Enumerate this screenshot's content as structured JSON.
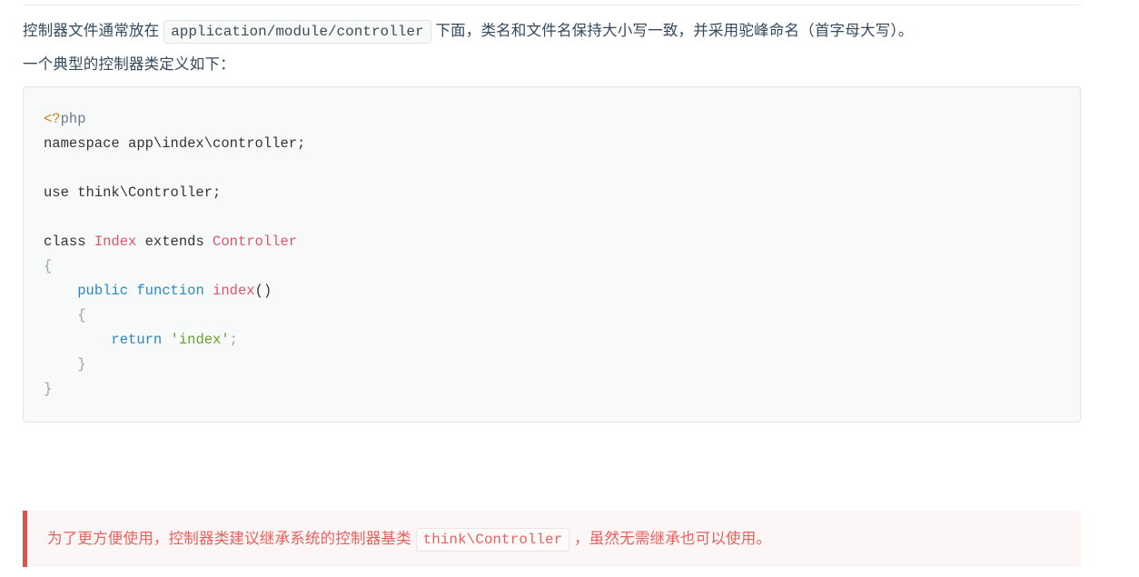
{
  "document": {
    "paragraphs": [
      {
        "id": "controller-location",
        "before": "控制器文件通常放在",
        "code": "application/module/controller",
        "after": "下面，类名和文件名保持大小写一致，并采用驼峰命名（首字母大写）。"
      },
      {
        "id": "typical-definition",
        "text": "一个典型的控制器类定义如下："
      }
    ],
    "code_block": {
      "language": "php",
      "lines": [
        "<?php",
        "namespace app\\index\\controller;",
        "",
        "use think\\Controller;",
        "",
        "class Index extends Controller",
        "{",
        "    public function index()",
        "    {",
        "        return 'index';",
        "    }",
        "}"
      ],
      "tokens": {
        "php_open": "<?",
        "php_word": "php",
        "namespace_line": "namespace app\\index\\controller;",
        "use_line": "use think\\Controller;",
        "class_keyword": "class ",
        "class_name": "Index",
        "extends_keyword": " extends ",
        "parent_class": "Controller",
        "brace_open_class": "{",
        "method_indent": "    ",
        "method_visibility": "public",
        "method_function_keyword": "function",
        "method_name": "index",
        "method_parens": "()",
        "brace_open_method": "    {",
        "return_indent": "        ",
        "return_keyword": "return",
        "return_value": "'index'",
        "return_semicolon": ";",
        "brace_close_method": "    }",
        "brace_close_class": "}"
      },
      "colors": {
        "background": "#f8faf9",
        "border": "#e3e5e4",
        "text": "#333333",
        "php_tag": "#c7811f",
        "php_word": "#6b7a8a",
        "class_name": "#e0536c",
        "keyword": "#2b86c5",
        "function_name": "#e0536c",
        "string": "#6a9f2e",
        "punctuation": "#9aa3a8"
      }
    },
    "alert": {
      "type": "danger",
      "before": "为了更方便使用，控制器类建议继承系统的控制器基类",
      "code": "think\\Controller",
      "after": "，虽然无需继承也可以使用。",
      "colors": {
        "background": "#fdf6f6",
        "border_left": "#d9534f",
        "text": "#e8615e"
      }
    },
    "colors": {
      "body_text": "#34495e",
      "rule": "#eaecef",
      "inline_code_bg": "#f8f9f9",
      "inline_code_border": "#e1e4e5"
    }
  }
}
